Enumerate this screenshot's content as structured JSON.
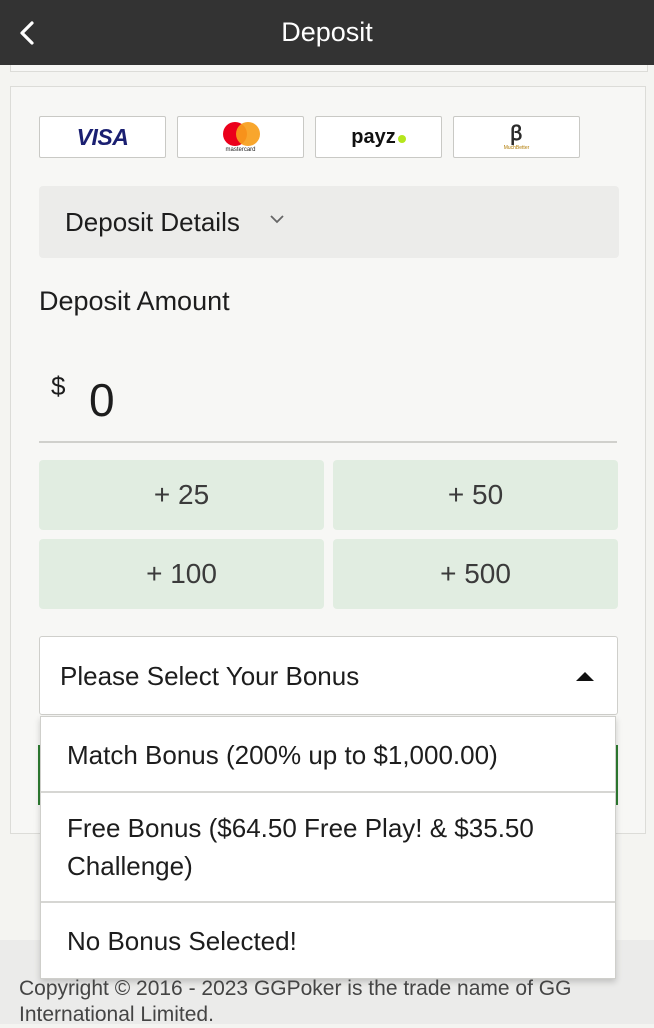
{
  "header": {
    "title": "Deposit"
  },
  "payment_methods": [
    {
      "name": "visa",
      "label": "VISA"
    },
    {
      "name": "mastercard",
      "label": "mastercard"
    },
    {
      "name": "payz",
      "label": "payz"
    },
    {
      "name": "muchbetter",
      "label": "MuchBetter"
    }
  ],
  "details": {
    "label": "Deposit Details"
  },
  "amount": {
    "label": "Deposit Amount",
    "currency": "$",
    "value": "0"
  },
  "quick_amounts": [
    "+ 25",
    "+ 50",
    "+ 100",
    "+ 500"
  ],
  "bonus": {
    "placeholder": "Please Select Your Bonus",
    "options": [
      "Match Bonus (200% up to $1,000.00)",
      "Free Bonus ($64.50 Free Play! & $35.50 Challenge)",
      "No Bonus Selected!"
    ]
  },
  "footer": {
    "copyright": "Copyright © 2016 - 2023 GGPoker is the trade name of GG International Limited."
  },
  "colors": {
    "header_bg": "#333333",
    "quick_btn_bg": "#e1ede1",
    "accent_green": "#2e7d32"
  }
}
